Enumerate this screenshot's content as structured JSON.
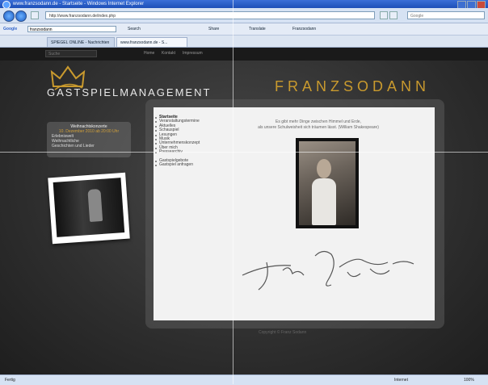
{
  "window": {
    "title": "www.franzsodann.de - Startseite - Windows Internet Explorer"
  },
  "address_bar": {
    "url": "http://www.franzsodann.de/index.php",
    "search_placeholder": "Google"
  },
  "google_toolbar": {
    "label": "Google",
    "search_value": "franzsodann",
    "items": [
      "Search",
      "Share",
      "Translate",
      "Franzsodann"
    ]
  },
  "tabs": [
    {
      "label": "SPIEGEL ONLINE - Nachrichten",
      "active": false
    },
    {
      "label": "www.franzsodann.de - S...",
      "active": true
    }
  ],
  "site": {
    "search_placeholder": "Suche",
    "topnav": [
      "Home",
      "Kontakt",
      "Impressum"
    ],
    "logo_text": "GASTSPIELMANAGEMENT",
    "brand": "FRANZSODANN",
    "infobox": {
      "heading": "Weihnachtskonzerte",
      "date": "10. Dezember 2010 ab 20:00 Uhr",
      "lines": [
        "Erlebniswelt",
        "Weihnachtliche",
        "Geschichten und Lieder"
      ]
    },
    "menu": [
      {
        "label": "Startseite",
        "bold": true
      },
      {
        "label": "Veranstaltungstermine",
        "bold": false
      },
      {
        "label": "Aktuelles",
        "bold": false
      },
      {
        "label": "Schauspiel",
        "bold": false
      },
      {
        "label": "Lesungen",
        "bold": false
      },
      {
        "label": "Musik",
        "bold": false
      },
      {
        "label": "Unternehmenskonzept",
        "bold": false
      },
      {
        "label": "Über mich",
        "bold": false
      },
      {
        "label": "Pressearchiv",
        "bold": false
      },
      {
        "label": "",
        "bold": false
      },
      {
        "label": "Gastspielgebote",
        "bold": false
      },
      {
        "label": "Gastspiel anfragen",
        "bold": false
      }
    ],
    "quote_line1": "Es gibt mehr Dinge zwischen Himmel und Erde,",
    "quote_line2": "als unsere Schulweisheit sich träumen lässt. (William Shakespeare)",
    "signature": "Franz Sodann",
    "footer": "Copyright © Franz Sodann"
  },
  "statusbar": {
    "status": "Fertig",
    "zone": "Internet",
    "zoom": "100%"
  }
}
